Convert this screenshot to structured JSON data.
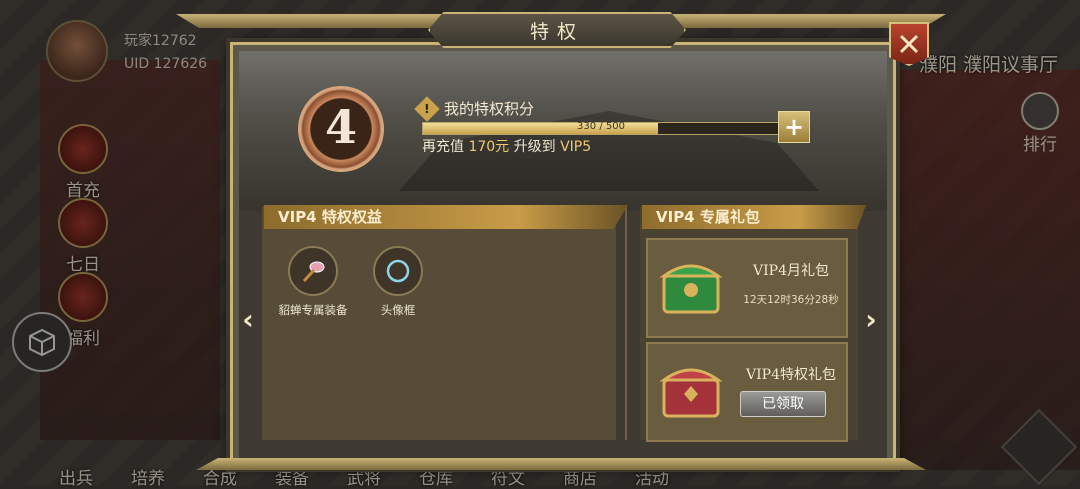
{
  "player": {
    "name": "玩家12762",
    "uid": "UID  127626"
  },
  "side_menu": [
    {
      "label": "首充"
    },
    {
      "label": "七日"
    },
    {
      "label": "福利"
    }
  ],
  "bottom_bar": [
    "出兵",
    "培养",
    "合成",
    "装备",
    "武将",
    "仓库",
    "符文",
    "商店",
    "活动"
  ],
  "location": "濮阳 濮阳议事厅",
  "rank_label": "排行",
  "dialog": {
    "title": "特权",
    "vip_level": "4",
    "points_title": "我的特权积分",
    "progress_text": "330 / 500",
    "progress_fraction": 0.66,
    "recharge_prefix": "再充值",
    "recharge_amount": "170元",
    "recharge_mid": "升级到",
    "recharge_target": "VIP5",
    "benefits_header": "VIP4 特权权益",
    "benefits": [
      {
        "label": "貂蝉专属装备",
        "icon": "fan-icon"
      },
      {
        "label": "头像框",
        "icon": "frame-icon"
      }
    ],
    "gifts_header": "VIP4 专属礼包",
    "gifts": [
      {
        "name": "VIP4月礼包",
        "timer": "12天12时36分28秒"
      },
      {
        "name": "VIP4特权礼包",
        "button": "已领取"
      }
    ]
  },
  "colors": {
    "gold": "#c9b375",
    "accent": "#f0c870",
    "close_red": "#b8442d"
  }
}
